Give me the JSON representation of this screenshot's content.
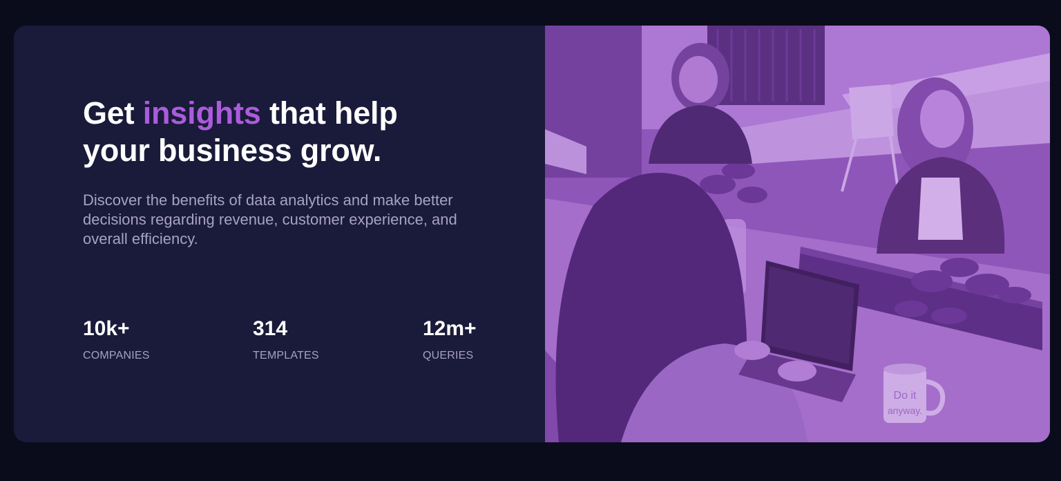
{
  "hero": {
    "headline_before": "Get ",
    "headline_accent": "insights",
    "headline_after": " that help your business grow.",
    "description": "Discover the benefits of data analytics and make better decisions regarding revenue, customer experience, and overall efficiency.",
    "stats": [
      {
        "value": "10k+",
        "label": "COMPANIES"
      },
      {
        "value": "314",
        "label": "TEMPLATES"
      },
      {
        "value": "12m+",
        "label": "QUERIES"
      }
    ]
  },
  "photo": {
    "mug_text": "Do it anyway."
  },
  "colors": {
    "page_background": "#0a0c1c",
    "card_background": "#1a1a3a",
    "accent": "#aa5cdb",
    "muted_text": "#a7a3c0",
    "photo_tint": "#9a5cc4"
  }
}
